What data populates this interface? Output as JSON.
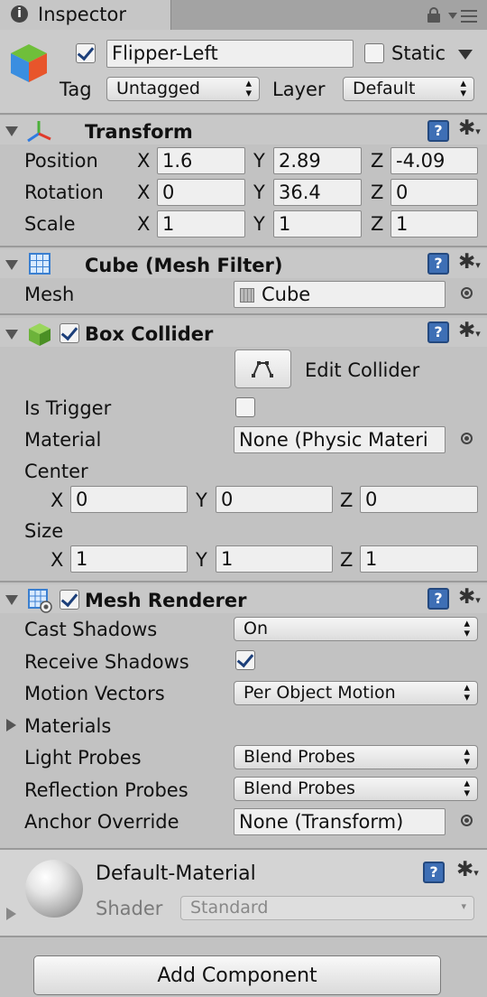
{
  "tab": {
    "title": "Inspector"
  },
  "object": {
    "name": "Flipper-Left",
    "active": true,
    "static_label": "Static",
    "static": false,
    "tag_label": "Tag",
    "tag_value": "Untagged",
    "layer_label": "Layer",
    "layer_value": "Default"
  },
  "transform": {
    "title": "Transform",
    "position": {
      "label": "Position",
      "x": "1.6",
      "y": "2.89",
      "z": "-4.09"
    },
    "rotation": {
      "label": "Rotation",
      "x": "0",
      "y": "36.4",
      "z": "0"
    },
    "scale": {
      "label": "Scale",
      "x": "1",
      "y": "1",
      "z": "1"
    },
    "axis": {
      "x": "X",
      "y": "Y",
      "z": "Z"
    }
  },
  "mesh_filter": {
    "title": "Cube (Mesh Filter)",
    "mesh_label": "Mesh",
    "mesh_value": "Cube"
  },
  "box_collider": {
    "title": "Box Collider",
    "enabled": true,
    "edit_label": "Edit Collider",
    "is_trigger_label": "Is Trigger",
    "is_trigger": false,
    "material_label": "Material",
    "material_value": "None (Physic Materi",
    "center_label": "Center",
    "center": {
      "x": "0",
      "y": "0",
      "z": "0"
    },
    "size_label": "Size",
    "size": {
      "x": "1",
      "y": "1",
      "z": "1"
    }
  },
  "mesh_renderer": {
    "title": "Mesh Renderer",
    "enabled": true,
    "cast_shadows_label": "Cast Shadows",
    "cast_shadows_value": "On",
    "receive_shadows_label": "Receive Shadows",
    "receive_shadows": true,
    "motion_vectors_label": "Motion Vectors",
    "motion_vectors_value": "Per Object Motion",
    "materials_label": "Materials",
    "light_probes_label": "Light Probes",
    "light_probes_value": "Blend Probes",
    "reflection_probes_label": "Reflection Probes",
    "reflection_probes_value": "Blend Probes",
    "anchor_override_label": "Anchor Override",
    "anchor_override_value": "None (Transform)"
  },
  "material": {
    "name": "Default-Material",
    "shader_label": "Shader",
    "shader_value": "Standard"
  },
  "add_component": {
    "label": "Add Component"
  },
  "icons": {
    "help": "?",
    "gear": "✱",
    "lock": "lock-icon",
    "menu": "menu-icon"
  },
  "colors": {
    "panel": "#c2c2c2",
    "header": "#c8c8c8",
    "help_blue": "#3e6fb5",
    "check": "#1c3f7a"
  }
}
